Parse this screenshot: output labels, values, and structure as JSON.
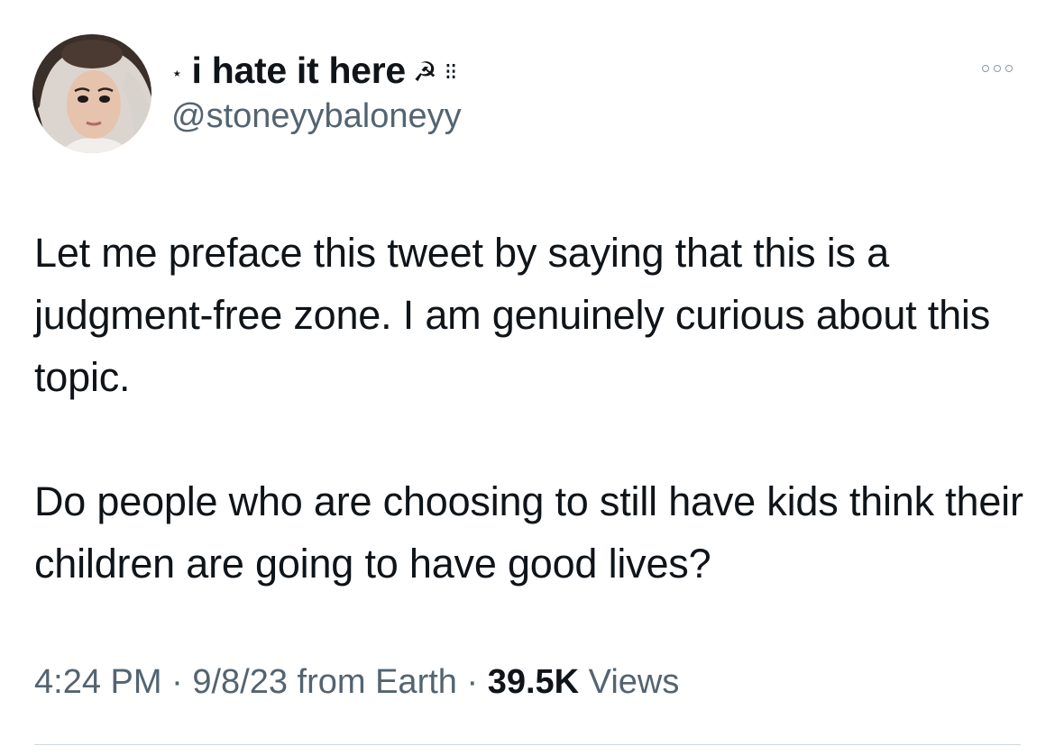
{
  "author": {
    "name_prefix": "⋆",
    "display_name": "i hate it here",
    "name_emoji": "☭",
    "name_suffix": "⁝⁝",
    "handle": "@stoneyybaloneyy"
  },
  "tweet": {
    "paragraphs": [
      "Let me preface this tweet by saying that this is a judgment-free zone. I am genuinely curious about this topic.",
      "Do people who are choosing to still have kids think their children are going to have good lives?"
    ]
  },
  "meta": {
    "time": "4:24 PM",
    "separator": " · ",
    "date": "9/8/23",
    "source": " from Earth",
    "views_count": "39.5K",
    "views_label": " Views"
  },
  "icons": {
    "more": "more-options-icon",
    "hammer_sickle": "hammer-sickle-icon"
  },
  "colors": {
    "text_primary": "#0f1419",
    "text_secondary": "#536471",
    "divider": "#cfd9de"
  }
}
